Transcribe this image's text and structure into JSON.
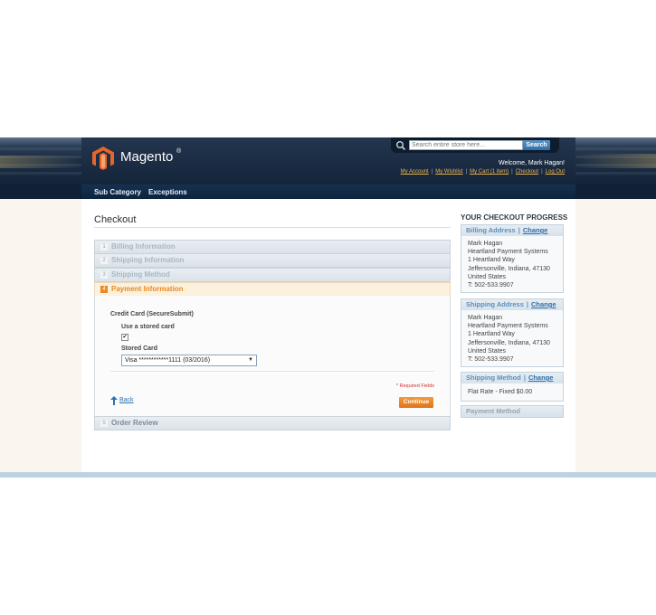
{
  "header": {
    "logo_text": "Magento",
    "logo_reg": "®",
    "search_placeholder": "Search entire store here...",
    "search_button": "Search",
    "welcome": "Welcome, Mark Hagan!",
    "links": [
      "My Account",
      "My Wishlist",
      "My Cart (1 item)",
      "Checkout",
      "Log Out"
    ]
  },
  "nav": {
    "items": [
      "Sub Category",
      "Exceptions"
    ]
  },
  "checkout": {
    "title": "Checkout",
    "steps": [
      {
        "num": "1",
        "label": "Billing Information"
      },
      {
        "num": "2",
        "label": "Shipping Information"
      },
      {
        "num": "3",
        "label": "Shipping Method"
      },
      {
        "num": "4",
        "label": "Payment Information"
      },
      {
        "num": "5",
        "label": "Order Review"
      }
    ],
    "payment": {
      "method_label": "Credit Card (SecureSubmit)",
      "use_stored_label": "Use a stored card",
      "use_stored_checked": "✔",
      "stored_card_label": "Stored Card",
      "stored_card_value": "Visa ************1111 (03/2016)",
      "required_note": "* Required Fields",
      "back_label": "Back",
      "continue_label": "Continue"
    }
  },
  "sidebar": {
    "title": "YOUR CHECKOUT PROGRESS",
    "change_label": "Change",
    "billing": {
      "heading": "Billing Address",
      "lines": [
        "Mark Hagan",
        "Heartland Payment Systems",
        "1 Heartland Way",
        "Jeffersonville, Indiana, 47130",
        "United States",
        "T: 502-533.9907"
      ]
    },
    "shipping": {
      "heading": "Shipping Address",
      "lines": [
        "Mark Hagan",
        "Heartland Payment Systems",
        "1 Heartland Way",
        "Jeffersonville, Indiana, 47130",
        "United States",
        "T: 502-533.9907"
      ]
    },
    "shipping_method": {
      "heading": "Shipping Method",
      "value": "Flat Rate - Fixed $0.00"
    },
    "payment_method": {
      "heading": "Payment Method"
    }
  },
  "colors": {
    "accent_orange": "#e98a24",
    "link_blue": "#2e72b6",
    "header_navy": "#1a2b42"
  }
}
